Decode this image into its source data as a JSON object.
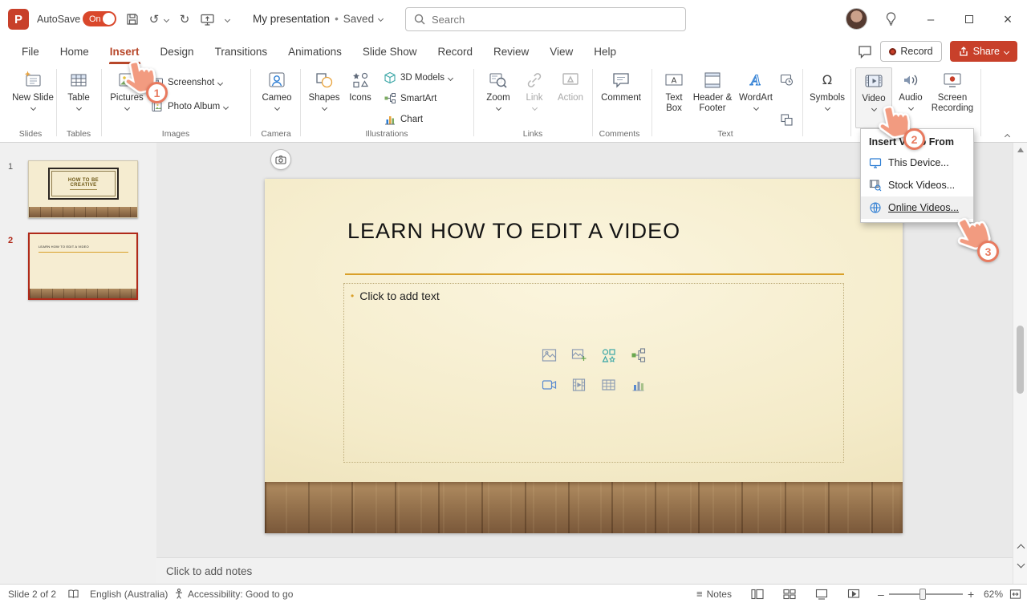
{
  "app": {
    "accent_color": "#c8402a",
    "tutorial_color": "#e87a5f"
  },
  "titlebar": {
    "autosave_label": "AutoSave",
    "autosave_state": "On",
    "doc_title": "My presentation",
    "separator": "•",
    "doc_status": "Saved",
    "search_placeholder": "Search"
  },
  "menubar": {
    "tabs": [
      "File",
      "Home",
      "Insert",
      "Design",
      "Transitions",
      "Animations",
      "Slide Show",
      "Record",
      "Review",
      "View",
      "Help"
    ],
    "active_tab": "Insert",
    "record_label": "Record",
    "share_label": "Share"
  },
  "ribbon": {
    "labels": {
      "new_slide": "New Slide",
      "table": "Table",
      "pictures": "Pictures",
      "screenshot": "Screenshot",
      "photo_album": "Photo Album",
      "cameo": "Cameo",
      "shapes": "Shapes",
      "icons": "Icons",
      "models_3d": "3D Models",
      "smartart": "SmartArt",
      "chart": "Chart",
      "zoom": "Zoom",
      "link": "Link",
      "action": "Action",
      "comment": "Comment",
      "text_box": "Text Box",
      "header_footer": "Header & Footer",
      "wordart": "WordArt",
      "symbols": "Symbols",
      "video": "Video",
      "audio": "Audio",
      "screen_recording": "Screen Recording"
    },
    "groups": [
      "Slides",
      "Tables",
      "Images",
      "Camera",
      "Illustrations",
      "Links",
      "Comments",
      "Text"
    ]
  },
  "slides_panel": {
    "slides": [
      {
        "number": "1",
        "title": "HOW TO BE CREATIVE"
      },
      {
        "number": "2",
        "title": "LEARN HOW TO EDIT A VIDEO"
      }
    ]
  },
  "canvas": {
    "slide_title": "LEARN HOW TO EDIT A VIDEO",
    "body_placeholder": "Click to add text"
  },
  "video_menu": {
    "header": "Insert Video From",
    "items": [
      {
        "label": "This Device..."
      },
      {
        "label": "Stock Videos..."
      },
      {
        "label": "Online Videos..."
      }
    ]
  },
  "tutorial": {
    "step1": "1",
    "step2": "2",
    "step3": "3"
  },
  "notes": {
    "placeholder": "Click to add notes"
  },
  "statusbar": {
    "slide_indicator": "Slide 2 of 2",
    "language": "English (Australia)",
    "accessibility_status": "Accessibility: Good to go",
    "notes_label": "Notes",
    "zoom_level": "62%"
  },
  "icons": {
    "logo": "P",
    "undo": "↺",
    "redo": "↻",
    "omega": "Ω",
    "letter_a": "A",
    "bullet": "•",
    "close": "×",
    "minimize": "–",
    "notes_lines": "≡",
    "zoom_out": "–",
    "zoom_in": "+"
  }
}
